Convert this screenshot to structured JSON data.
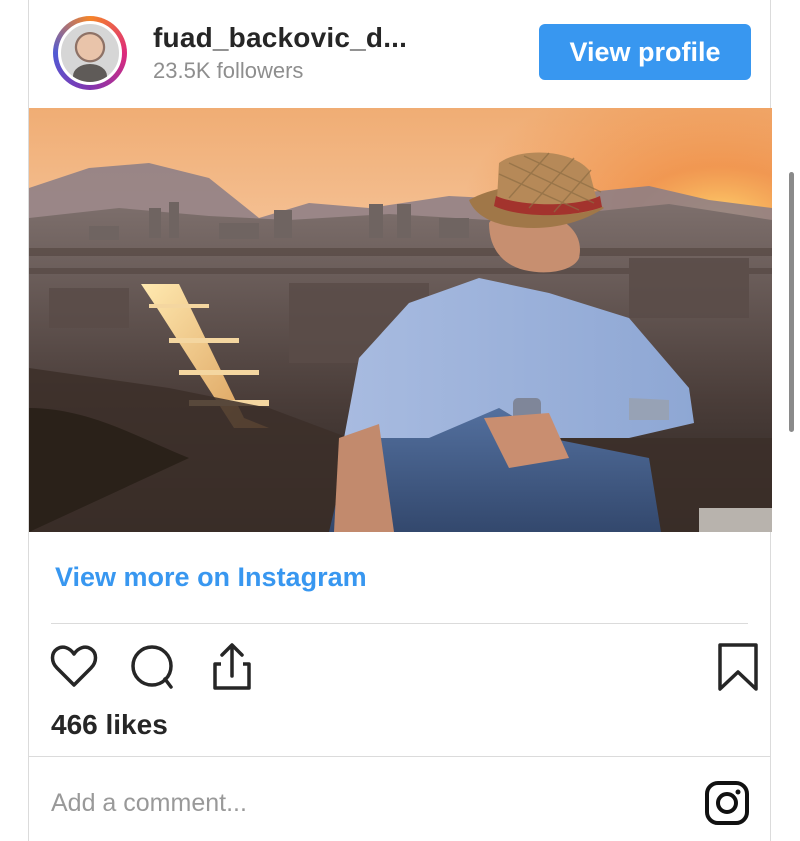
{
  "post": {
    "username": "fuad_backovic_d...",
    "followers": "23.5K followers",
    "view_profile_label": "View profile",
    "view_more_label": "View more on Instagram",
    "likes": "466 likes",
    "comment_placeholder": "Add a comment..."
  },
  "colors": {
    "accent": "#3897f0",
    "text": "#262626",
    "muted": "#8e8e8e",
    "divider": "#dbdbdb"
  },
  "icons": {
    "like": "heart-icon",
    "comment": "comment-icon",
    "share": "share-icon",
    "save": "bookmark-icon",
    "instagram": "instagram-icon"
  }
}
